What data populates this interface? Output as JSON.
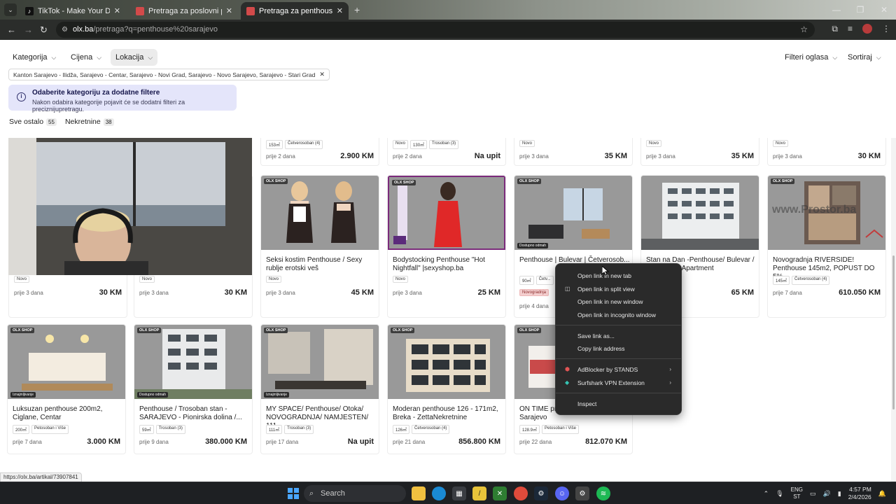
{
  "browser": {
    "tabs": [
      {
        "title": "TikTok - Make Your Day",
        "active": false
      },
      {
        "title": "Pretraga za poslovni prostor",
        "active": false
      },
      {
        "title": "Pretraga za penthouse sarajevo",
        "active": true
      }
    ],
    "url_host": "olx.ba",
    "url_path": "/pretraga?q=penthouse%20sarajevo",
    "status_url": "https://olx.ba/artikal/73907841"
  },
  "filters": {
    "kategorija": "Kategorija",
    "cijena": "Cijena",
    "lokacija": "Lokacija",
    "filteri_oglasa": "Filteri oglasa",
    "sortiraj": "Sortiraj",
    "location_chip": "Kanton Sarajevo - Ilidža, Sarajevo - Centar, Sarajevo - Novi Grad, Sarajevo - Novo Sarajevo, Sarajevo - Stari Grad"
  },
  "notice": {
    "title": "Odaberite kategoriju za dodatne filtere",
    "body": "Nakon odabira kategorije pojavit će se dodatni filteri za preciznijupretragu."
  },
  "counts": [
    {
      "label": "Sve ostalo",
      "count": "55"
    },
    {
      "label": "Nekretnine",
      "count": "38"
    }
  ],
  "top_row": [
    {
      "tags": [
        "153㎡",
        "Četverosoban (4)"
      ],
      "date": "prije 2 dana",
      "price": "2.900 KM"
    },
    {
      "tags": [
        "Novo",
        "130㎡",
        "Trosoban (3)"
      ],
      "date": "prije 2 dana",
      "price": "Na upit"
    },
    {
      "tags": [
        "Novo"
      ],
      "date": "prije 3 dana",
      "price": "35 KM"
    },
    {
      "tags": [
        "Novo"
      ],
      "date": "prije 3 dana",
      "price": "35 KM"
    },
    {
      "tags": [
        "Novo"
      ],
      "date": "prije 3 dana",
      "price": "30 KM"
    }
  ],
  "row2": [
    {
      "title": "",
      "tags": [
        "Novo"
      ],
      "date": "prije 3 dana",
      "price": "30 KM"
    },
    {
      "title": "",
      "tags": [
        "Novo"
      ],
      "date": "prije 3 dana",
      "price": "30 KM"
    },
    {
      "title": "Seksi kostim Penthouse / Sexy rublje erotski veš",
      "tags": [
        "Novo"
      ],
      "date": "prije 3 dana",
      "price": "45 KM",
      "badge": "OLX SHOP"
    },
    {
      "title": "Bodystocking Penthouse \"Hot Nightfall\" |sexyshop.ba",
      "tags": [
        "Novo"
      ],
      "date": "prije 3 dana",
      "price": "25 KM",
      "badge": "OLX SHOP"
    },
    {
      "title": "Penthouse | Bulevar | Četverosob...",
      "tags": [
        "90㎡",
        "Četv..."
      ],
      "tag2": "Novogradnja",
      "date": "prije 4 dana",
      "price": "",
      "badge": "OLX SHOP",
      "dost": "Dostupno odmah"
    },
    {
      "title": "Stan na Dan -Penthouse/ Bulevar / ...Premium Apartment",
      "tags": [],
      "date": "",
      "price": "65 KM"
    },
    {
      "title": "Novogradnja RIVERSIDE! Penthouse 145m2, POPUST DO 5%",
      "tags": [
        "145㎡",
        "Četverosoban (4)"
      ],
      "date": "prije 7 dana",
      "price": "610.050 KM",
      "badge": "OLX SHOP",
      "watermark": "www.Prostor.ba"
    }
  ],
  "row3": [
    {
      "title": "Luksuzan penthouse 200m2, Ciglane, Centar",
      "tags": [
        "200㎡",
        "Petosoban i Više"
      ],
      "date": "prije 7 dana",
      "price": "3.000 KM",
      "badge": "OLX SHOP",
      "dost": "Iznajmljivanje"
    },
    {
      "title": "Penthouse / Trosoban stan - SARAJEVO - Pionirska dolina /...",
      "tags": [
        "59㎡",
        "Trosoban (3)"
      ],
      "date": "prije 9 dana",
      "price": "380.000 KM",
      "badge": "OLX SHOP",
      "dost": "Dostupno odmah"
    },
    {
      "title": "MY SPACE/ Penthouse/ Otoka/ NOVOGRADNJA/ NAMJESTEN/ 111...",
      "tags": [
        "111㎡",
        "Trosoban (3)"
      ],
      "date": "prije 17 dana",
      "price": "Na upit",
      "badge": "OLX SHOP",
      "dost": "Iznajmljivanje"
    },
    {
      "title": "Moderan penthouse 126 - 171m2, Breka - ZettaNekretnine",
      "tags": [
        "126㎡",
        "Četverosoban (4)"
      ],
      "date": "prije 21 dana",
      "price": "856.800 KM",
      "badge": "OLX SHOP"
    },
    {
      "title": "ON TIME pr... Petosoban, Breka, Sarajevo",
      "tags": [
        "128.9㎡",
        "Petosoban i Više"
      ],
      "date": "prije 22 dana",
      "price": "812.070 KM",
      "badge": "OLX SHOP"
    }
  ],
  "context_menu": {
    "items": [
      "Open link in new tab",
      "Open link in split view",
      "Open link in new window",
      "Open link in incognito window",
      "Save link as...",
      "Copy link address",
      "AdBlocker by STANDS",
      "Surfshark VPN Extension",
      "Inspect"
    ]
  },
  "taskbar": {
    "search": "Search",
    "lang1": "ENG",
    "lang2": "ST",
    "time": "4:57 PM",
    "date": "2/4/2026"
  },
  "colors": {
    "olx_shop_badge": "#3d3d3d",
    "notice_bg": "#e4e5fa",
    "context_bg": "#2a2a2a",
    "taskbar_bg": "#1e2023"
  }
}
